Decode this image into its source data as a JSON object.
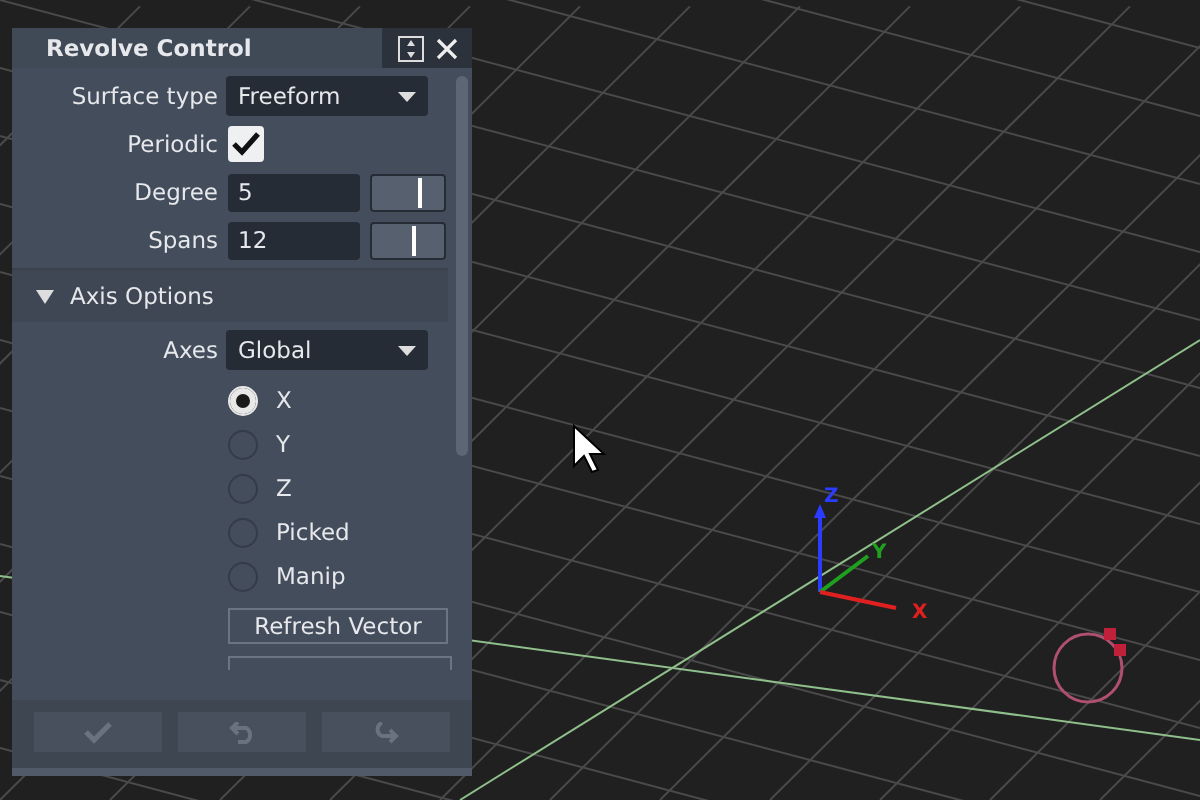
{
  "panel": {
    "title": "Revolve Control",
    "surface_type": {
      "label": "Surface type",
      "value": "Freeform"
    },
    "periodic": {
      "label": "Periodic",
      "checked": true
    },
    "degree": {
      "label": "Degree",
      "value": "5",
      "level": 0.64
    },
    "spans": {
      "label": "Spans",
      "value": "12",
      "level": 0.56
    },
    "axis_options": {
      "label": "Axis Options",
      "expanded": true,
      "axes": {
        "label": "Axes",
        "value": "Global"
      },
      "radios": [
        {
          "label": "X",
          "selected": true
        },
        {
          "label": "Y",
          "selected": false
        },
        {
          "label": "Z",
          "selected": false
        },
        {
          "label": "Picked",
          "selected": false
        },
        {
          "label": "Manip",
          "selected": false
        }
      ],
      "refresh_button": "Refresh Vector"
    }
  },
  "viewport": {
    "axis_labels": [
      {
        "label": "Z",
        "color": "#2a3cff"
      },
      {
        "label": "Y",
        "color": "#1fa01f"
      },
      {
        "label": "X",
        "color": "#e02020"
      }
    ]
  }
}
